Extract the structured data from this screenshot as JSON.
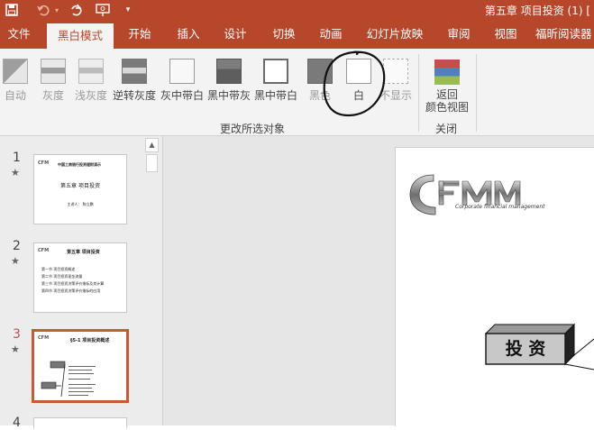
{
  "window": {
    "title": "第五章 项目投资 (1) [",
    "titlebar_color": "#b7472a",
    "quick_access": {
      "save_icon": "save-icon",
      "undo_icon": "undo-icon",
      "redo_icon": "redo-icon",
      "presenter_icon": "present-icon",
      "customize_icon": "chevron-down-icon"
    }
  },
  "tabs": [
    {
      "label": "文件",
      "active": false
    },
    {
      "label": "黑白模式",
      "active": true
    },
    {
      "label": "开始",
      "active": false
    },
    {
      "label": "插入",
      "active": false
    },
    {
      "label": "设计",
      "active": false
    },
    {
      "label": "切换",
      "active": false
    },
    {
      "label": "动画",
      "active": false
    },
    {
      "label": "幻灯片放映",
      "active": false
    },
    {
      "label": "审阅",
      "active": false
    },
    {
      "label": "视图",
      "active": false
    },
    {
      "label": "福昕阅读器",
      "active": false
    }
  ],
  "ribbon": {
    "group1_label": "更改所选对象",
    "group2_label": "关闭",
    "buttons": [
      {
        "label": "自动",
        "icon": "auto-mode-icon",
        "enabled": false
      },
      {
        "label": "灰度",
        "icon": "grayscale-icon",
        "enabled": false
      },
      {
        "label": "浅灰度",
        "icon": "light-grayscale-icon",
        "enabled": false
      },
      {
        "label": "逆转灰度",
        "icon": "inverse-grayscale-icon",
        "enabled": true
      },
      {
        "label": "灰中带白",
        "icon": "gray-with-white-icon",
        "enabled": true
      },
      {
        "label": "黑中带灰",
        "icon": "black-with-gray-icon",
        "enabled": true
      },
      {
        "label": "黑中带白",
        "icon": "black-with-white-icon",
        "enabled": true
      },
      {
        "label": "黑色",
        "icon": "black-icon",
        "enabled": false
      },
      {
        "label": "白",
        "icon": "white-icon",
        "enabled": true
      },
      {
        "label": "不显示",
        "icon": "dont-show-icon",
        "enabled": false
      }
    ],
    "close_button": {
      "label_line1": "返回",
      "label_line2": "颜色视图",
      "icon": "color-view-icon"
    }
  },
  "slides": [
    {
      "number": "1",
      "star": "★",
      "thumb_header": "中国工商银行投资理财演示",
      "thumb_title": "第五章  项目投资",
      "thumb_author": "主讲人：  陈立鹏"
    },
    {
      "number": "2",
      "star": "★",
      "thumb_title": "第五章  项目投资",
      "thumb_lines": [
        "第一节  项目投资概述",
        "第二节  项目投资现金流量",
        "第三节  项目投资决策评价指标及其计算",
        "第四节  项目投资决策评价指标的应用"
      ]
    },
    {
      "number": "3",
      "star": "★",
      "thumb_title": "§5-1  项目投资概述",
      "selected": true
    },
    {
      "number": "4"
    }
  ],
  "main_slide": {
    "logo_text": "CFM",
    "logo_subtitle": "Corporate financial management",
    "box_label": "投 资"
  },
  "colors": {
    "accent": "#b7472a",
    "selected_thumb_border": "#c55a35",
    "active_number": "#c0504d"
  }
}
